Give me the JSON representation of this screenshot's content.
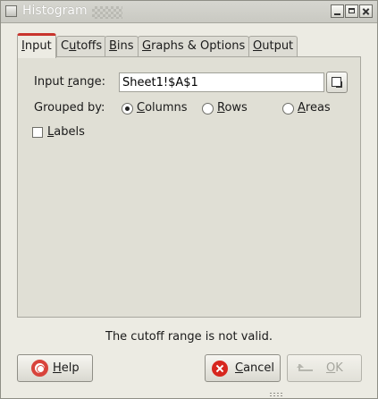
{
  "window": {
    "title": "Histogram"
  },
  "tabs": [
    {
      "pre": "",
      "mnemonic": "I",
      "post": "nput",
      "active": true
    },
    {
      "pre": "C",
      "mnemonic": "u",
      "post": "toffs",
      "active": false
    },
    {
      "pre": "",
      "mnemonic": "B",
      "post": "ins",
      "active": false
    },
    {
      "pre": "",
      "mnemonic": "G",
      "post": "raphs & Options",
      "active": false
    },
    {
      "pre": "",
      "mnemonic": "O",
      "post": "utput",
      "active": false
    }
  ],
  "input_tab": {
    "range_label_pre": "Input ",
    "range_label_mnemonic": "r",
    "range_label_post": "ange:",
    "range_value": "Sheet1!$A$1",
    "grouped_by_label": "Grouped by:",
    "grouping": {
      "columns": {
        "pre": "",
        "mnemonic": "C",
        "post": "olumns",
        "checked": true
      },
      "rows": {
        "pre": "",
        "mnemonic": "R",
        "post": "ows",
        "checked": false
      },
      "areas": {
        "pre": "",
        "mnemonic": "A",
        "post": "reas",
        "checked": false
      }
    },
    "labels": {
      "pre": "",
      "mnemonic": "L",
      "post": "abels",
      "checked": false
    }
  },
  "status": {
    "message": "The cutoff range is not valid."
  },
  "buttons": {
    "help": {
      "pre": "",
      "mnemonic": "H",
      "post": "elp"
    },
    "cancel": {
      "pre": "",
      "mnemonic": "C",
      "post": "ancel"
    },
    "ok": {
      "pre": "",
      "mnemonic": "O",
      "post": "K",
      "enabled": false
    }
  }
}
